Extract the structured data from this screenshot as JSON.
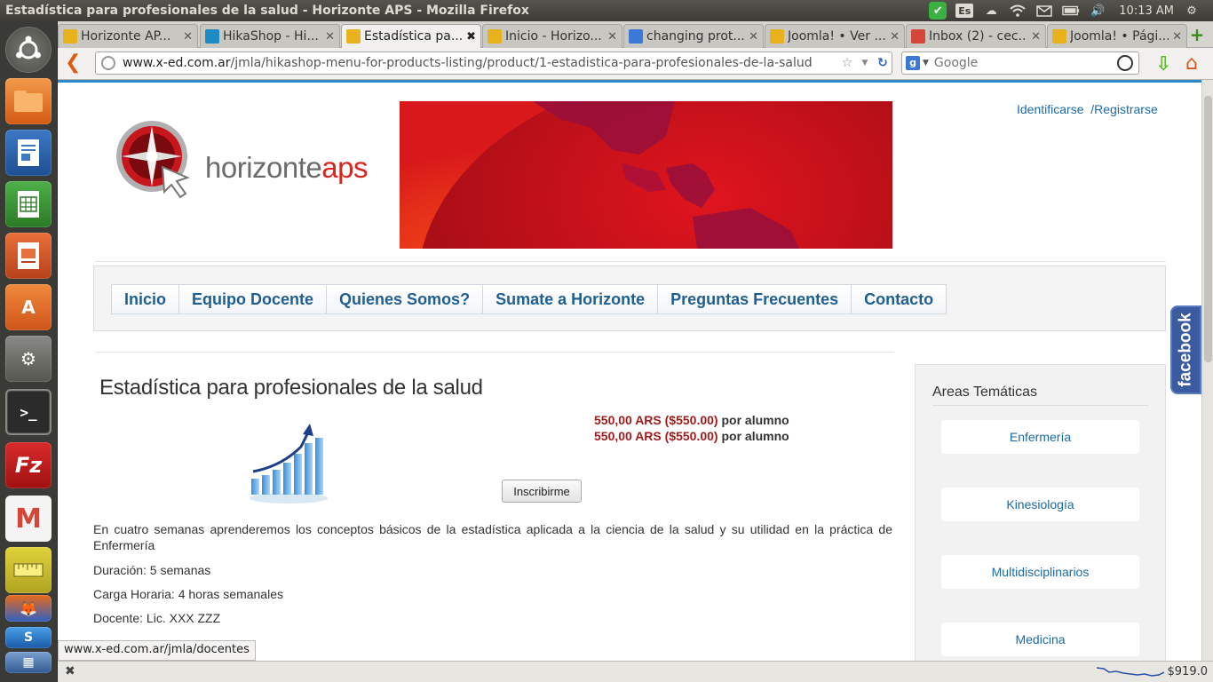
{
  "window": {
    "title": "Estadística para profesionales de la salud - Horizonte APS - Mozilla Firefox"
  },
  "tray": {
    "keyboard": "Es",
    "clock": "10:13 AM"
  },
  "tabs": [
    {
      "label": "Horizonte AP...",
      "icon_color": "#e8b21c"
    },
    {
      "label": "HikaShop - Hi...",
      "icon_color": "#1e8bc3"
    },
    {
      "label": "Estadística pa...",
      "icon_color": "#e8b21c",
      "active": true
    },
    {
      "label": "Inicio - Horizo...",
      "icon_color": "#e8b21c"
    },
    {
      "label": "changing prot...",
      "icon_color": "#3b78d8"
    },
    {
      "label": "Joomla! • Ver ...",
      "icon_color": "#e8b21c"
    },
    {
      "label": "Inbox (2) - cec...",
      "icon_color": "#d44638"
    },
    {
      "label": "Joomla! • Pági...",
      "icon_color": "#e8b21c"
    }
  ],
  "urlbar": {
    "domain": "www.x-ed.com.ar",
    "path": "/jmla/hikashop-menu-for-products-listing/product/1-estadistica-para-profesionales-de-la-salud"
  },
  "searchbar": {
    "placeholder": "Google",
    "engine_letter": "g"
  },
  "page": {
    "login": {
      "signin": "Identificarse",
      "register": "/Registrarse"
    },
    "logo": {
      "text_main": "horizonte",
      "text_accent": "aps"
    },
    "menu": [
      "Inicio",
      "Equipo Docente",
      "Quienes Somos?",
      "Sumate a Horizonte",
      "Preguntas Frecuentes",
      "Contacto"
    ],
    "facebook_label": "facebook",
    "product": {
      "title": "Estadística para profesionales de la salud",
      "prices": [
        {
          "value": "550,00 ARS ($550.00)",
          "unit": " por alumno"
        },
        {
          "value": "550,00 ARS ($550.00)",
          "unit": " por alumno"
        }
      ],
      "enroll_button": "Inscribirme",
      "description": "En cuatro semanas aprenderemos los conceptos básicos de la estadística aplicada a la ciencia de la salud y su utilidad en la práctica de Enfermería",
      "duration": "Duración: 5 semanas",
      "hours": "Carga Horaria: 4 horas semanales",
      "teacher": "Docente: Lic. XXX ZZZ"
    },
    "sidebar": {
      "title": "Areas Temáticas",
      "categories": [
        "Enfermería",
        "Kinesiología",
        "Multidisciplinarios",
        "Medicina"
      ]
    }
  },
  "status": {
    "link_preview": "www.x-ed.com.ar/jmla/docentes",
    "ticker": "$919.0"
  },
  "colors": {
    "accent": "#1f5f93",
    "price": "#a01c1c",
    "facebook": "#3b5ba0"
  }
}
